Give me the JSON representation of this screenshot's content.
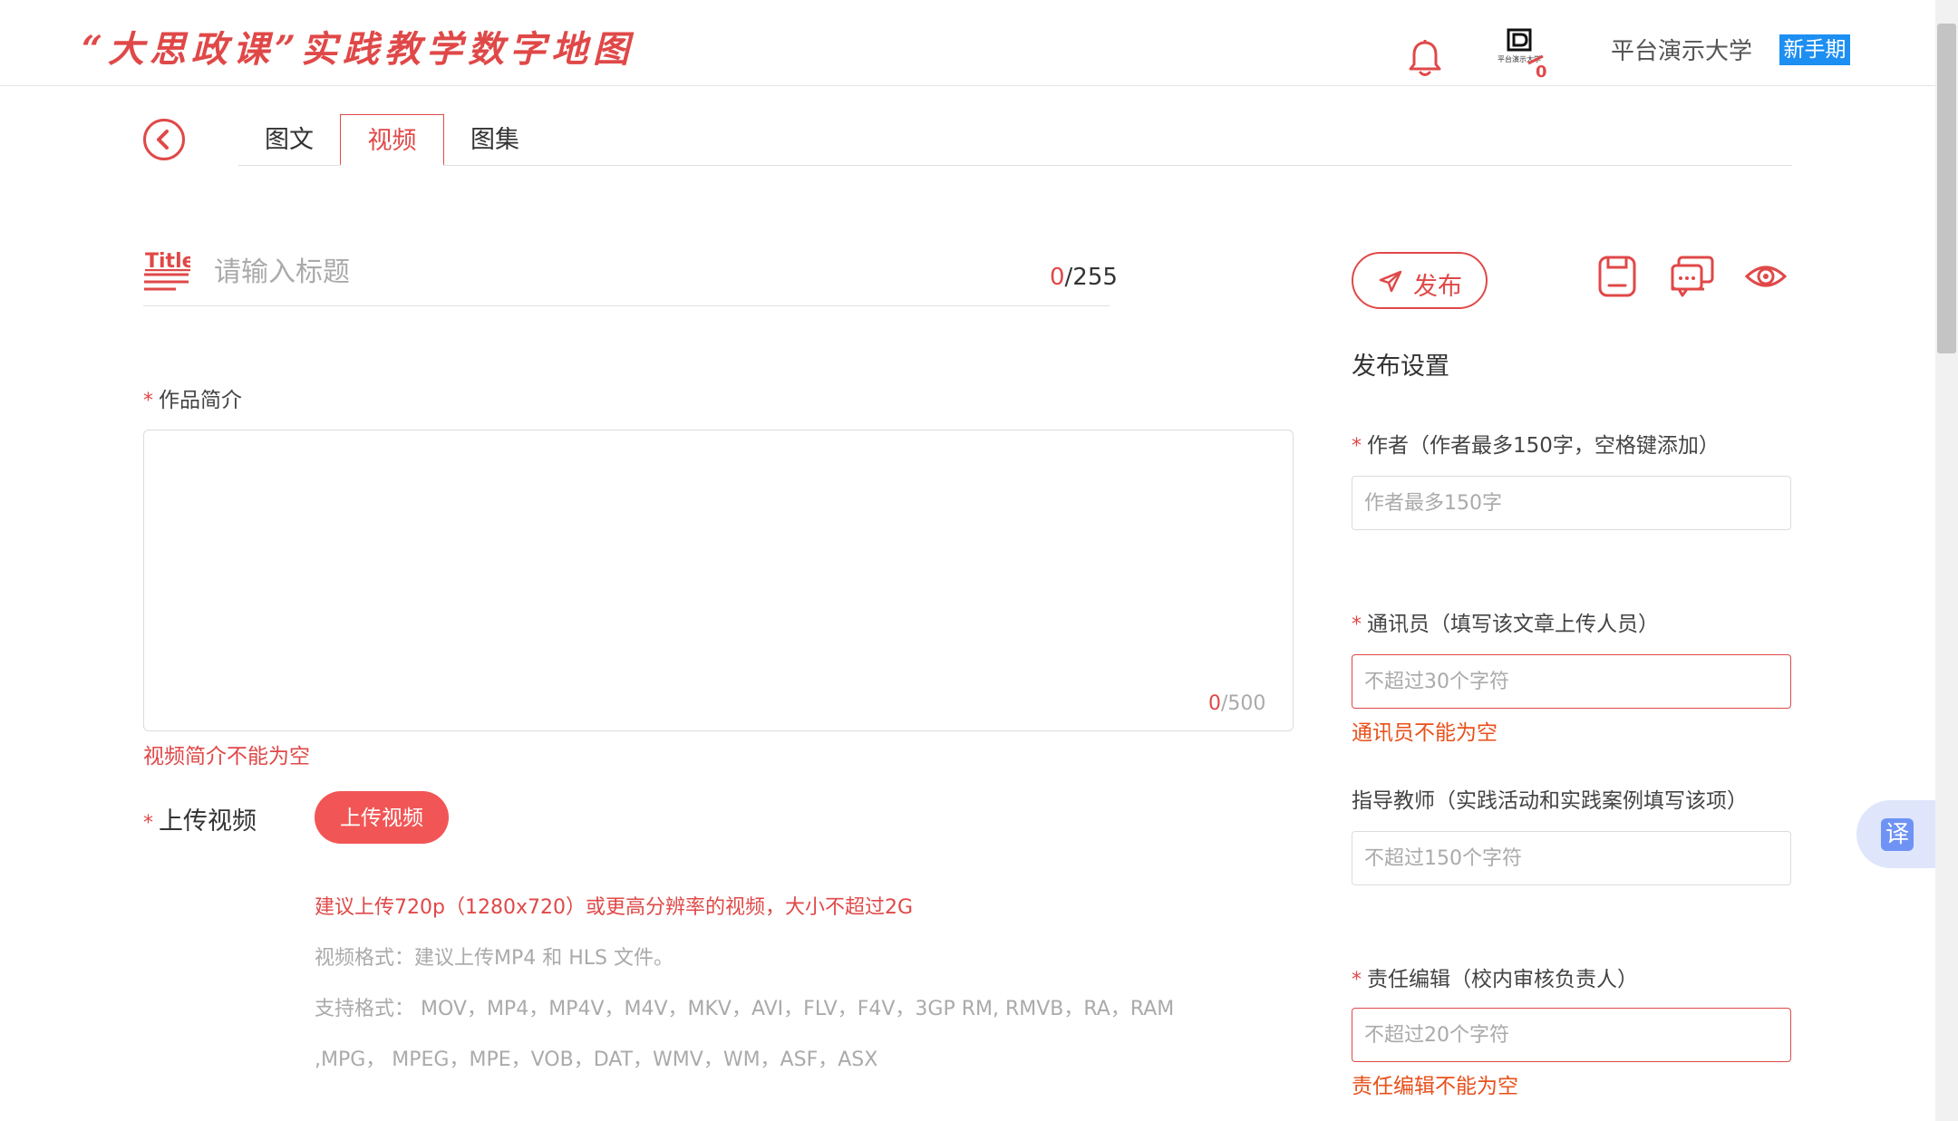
{
  "header": {
    "site_title": "“大思政课”实践教学数字地图",
    "user_logo_caption": "平台演示大学",
    "user_logo_badge": "0",
    "user_name": "平台演示大学",
    "badge": "新手期"
  },
  "tabs": [
    {
      "label": "图文",
      "active": false
    },
    {
      "label": "视频",
      "active": true
    },
    {
      "label": "图集",
      "active": false
    }
  ],
  "title_field": {
    "icon_label": "Title",
    "placeholder": "请输入标题",
    "count_current": "0",
    "count_max": "/255"
  },
  "intro": {
    "required_mark": "*",
    "label": "作品简介",
    "count_current": "0",
    "count_max": "/500",
    "error": "视频简介不能为空"
  },
  "upload": {
    "required_mark": "*",
    "label": "上传视频",
    "button": "上传视频",
    "note_resolution": "建议上传720p（1280x720）或更高分辨率的视频，大小不超过2G",
    "note_format": "视频格式：建议上传MP4 和 HLS 文件。",
    "note_supported_1": "支持格式： MOV，MP4，MP4V，M4V，MKV，AVI，FLV，F4V，3GP RM, RMVB，RA，RAM",
    "note_supported_2": ",MPG， MPEG，MPE，VOB，DAT，WMV，WM，ASF，ASX"
  },
  "actions": {
    "publish": "发布",
    "icons": [
      "save-icon",
      "comment-icon",
      "preview-icon"
    ]
  },
  "settings": {
    "title": "发布设置",
    "author": {
      "required_mark": "*",
      "label": "作者（作者最多150字，空格键添加）",
      "placeholder": "作者最多150字"
    },
    "correspondent": {
      "required_mark": "*",
      "label": "通讯员（填写该文章上传人员）",
      "placeholder": "不超过30个字符",
      "error": "通讯员不能为空"
    },
    "instructor": {
      "label": "指导教师（实践活动和实践案例填写该项）",
      "placeholder": "不超过150个字符"
    },
    "editor": {
      "required_mark": "*",
      "label": "责任编辑（校内审核负责人）",
      "placeholder": "不超过20个字符",
      "error": "责任编辑不能为空"
    }
  },
  "translate_button": "译",
  "colors": {
    "accent": "#e04848",
    "error_orange": "#e8501a",
    "badge_blue": "#1e8ff2",
    "translate_blue": "#6f93f4"
  }
}
